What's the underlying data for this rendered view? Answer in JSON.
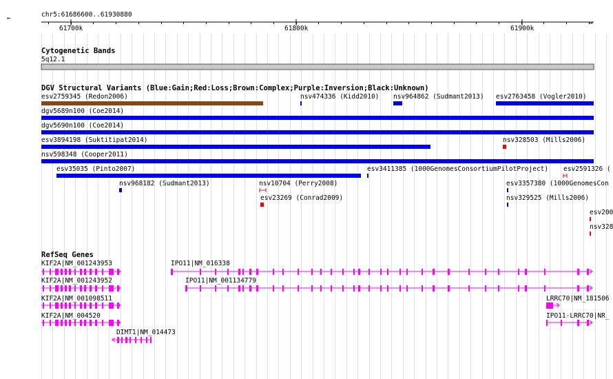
{
  "ruler": {
    "range_label": "chr5:61686600..61930880",
    "ticks": [
      "61700k",
      "61800k",
      "61900k"
    ]
  },
  "cytoband": {
    "title": "Cytogenetic Bands",
    "band_label": "5q12.1"
  },
  "dgv": {
    "title": "DGV Structural Variants (Blue:Gain;Red:Loss;Brown:Complex;Purple:Inversion;Black:Unknown)",
    "colors": {
      "gain": "#0000ff",
      "loss": "#ff0000",
      "complex": "#8b4513"
    },
    "features": [
      {
        "label": "esv2759345 (Redon2006)",
        "type": "complex"
      },
      {
        "label": "nsv474336 (Kidd2010)",
        "type": "gain"
      },
      {
        "label": "nsv964862 (Sudmant2013)",
        "type": "gain"
      },
      {
        "label": "esv2763458 (Vogler2010)",
        "type": "gain"
      },
      {
        "label": "dgv5689n100 (Coe2014)",
        "type": "gain"
      },
      {
        "label": "dgv5690n100 (Coe2014)",
        "type": "gain"
      },
      {
        "label": "esv3894198 (Suktitipat2014)",
        "type": "gain"
      },
      {
        "label": "nsv328503 (Mills2006)",
        "type": "loss"
      },
      {
        "label": "nsv598348 (Cooper2011)",
        "type": "gain"
      },
      {
        "label": "esv35035 (Pinto2007)",
        "type": "gain"
      },
      {
        "label": "esv3411385 (1000GenomesConsortiumPilotProject)",
        "type": "gain"
      },
      {
        "label": "esv2591326 (",
        "type": "loss"
      },
      {
        "label": "nsv968182 (Sudmant2013)",
        "type": "gain"
      },
      {
        "label": "nsv10704 (Perry2008)",
        "type": "loss"
      },
      {
        "label": "esv3357380 (1000GenomesCon",
        "type": "gain"
      },
      {
        "label": "esv23269 (Conrad2009)",
        "type": "loss"
      },
      {
        "label": "nsv329525 (Mills2006)",
        "type": "gain"
      },
      {
        "label": "esv200",
        "type": "loss"
      },
      {
        "label": "nsv328",
        "type": "loss"
      }
    ]
  },
  "refseq": {
    "title": "RefSeq Genes",
    "color": "#ff00ff",
    "genes": [
      {
        "label": "KIF2A|NM_001243953"
      },
      {
        "label": "IPO11|NM_016338"
      },
      {
        "label": "KIF2A|NM_001243952"
      },
      {
        "label": "IPO11|NM_001134779"
      },
      {
        "label": "KIF2A|NM_001098511"
      },
      {
        "label": "LRRC70|NM_181506"
      },
      {
        "label": "KIF2A|NM_004520"
      },
      {
        "label": "IPO11-LRRC70|NR_"
      },
      {
        "label": "DIMT1|NM_014473"
      }
    ]
  }
}
